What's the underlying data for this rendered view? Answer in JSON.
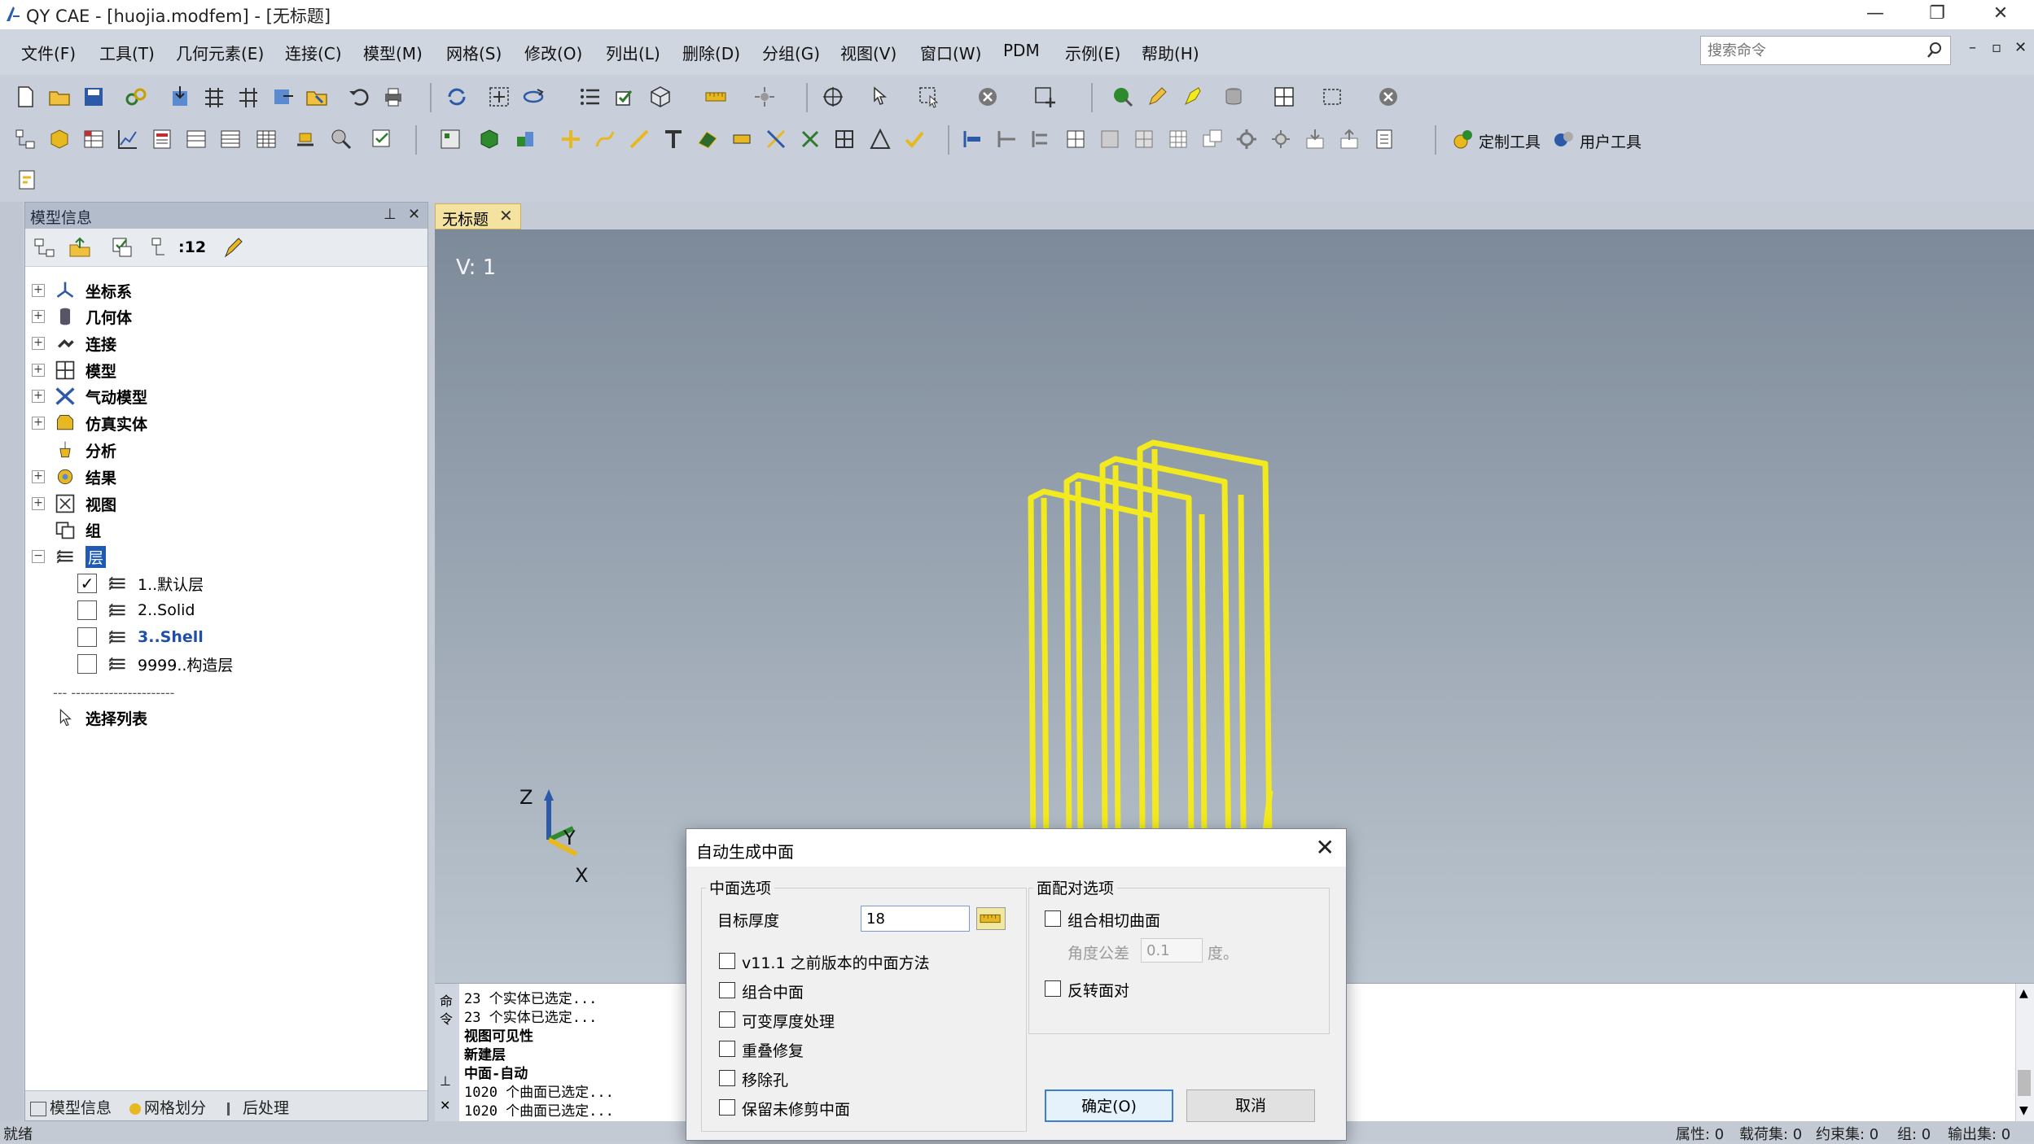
{
  "window": {
    "title": "QY CAE - [huojia.modfem] - [无标题]",
    "minimize": "—",
    "restore": "❐",
    "close": "✕"
  },
  "menu": {
    "items": [
      "文件(F)",
      "工具(T)",
      "几何元素(E)",
      "连接(C)",
      "模型(M)",
      "网格(S)",
      "修改(O)",
      "列出(L)",
      "删除(D)",
      "分组(G)",
      "视图(V)",
      "窗口(W)",
      "PDM",
      "示例(E)",
      "帮助(H)"
    ],
    "search_placeholder": "搜索命令",
    "mdi_min": "–",
    "mdi_restore": "▫",
    "mdi_close": "✕"
  },
  "toolbar": {
    "custom_tools": "定制工具",
    "user_tools": "用户工具"
  },
  "left_panel": {
    "title": "模型信息",
    "pin": "⊥",
    "close": "✕",
    "layer_count": ":12",
    "tree": [
      {
        "label": "坐标系",
        "expand": "+"
      },
      {
        "label": "几何体",
        "expand": "+"
      },
      {
        "label": "连接",
        "expand": "+"
      },
      {
        "label": "模型",
        "expand": "+"
      },
      {
        "label": "气动模型",
        "expand": "+"
      },
      {
        "label": "仿真实体",
        "expand": "+"
      },
      {
        "label": "分析",
        "expand": ""
      },
      {
        "label": "结果",
        "expand": "+"
      },
      {
        "label": "视图",
        "expand": "+"
      },
      {
        "label": "组",
        "expand": ""
      },
      {
        "label": "层",
        "expand": "−"
      }
    ],
    "layers": [
      {
        "label": "1..默认层",
        "checked": "✓"
      },
      {
        "label": "2..Solid",
        "checked": ""
      },
      {
        "label": "3..Shell",
        "checked": ""
      },
      {
        "label": "9999..构造层",
        "checked": ""
      }
    ],
    "separator": "--- ----------------------",
    "selection_list": "选择列表",
    "tabs": [
      "模型信息",
      "网格划分",
      "后处理"
    ]
  },
  "document": {
    "tab_label": "无标题",
    "tab_close": "✕",
    "view_label": "V: 1",
    "axis_z": "Z",
    "axis_y": "Y",
    "axis_x": "X",
    "model_color": "#f2ea1e"
  },
  "output": {
    "strip_labels": [
      "命",
      "令",
      "⊥",
      "✕"
    ],
    "lines": [
      "23 个实体已选定...",
      "23 个实体已选定...",
      "视图可见性",
      "新建层",
      "中面-自动",
      "1020 个曲面已选定...",
      "1020 个曲面已选定..."
    ]
  },
  "status": {
    "left": "就绪",
    "fields": [
      "属性: 0",
      "载荷集: 0",
      "约束集: 0",
      "组: 0",
      "输出集: 0"
    ]
  },
  "dialog": {
    "title": "自动生成中面",
    "close": "✕",
    "midsurface_group": "中面选项",
    "target_thickness_label": "目标厚度",
    "target_thickness_value": "18",
    "ruler_icon": "ruler-icon",
    "options": [
      "v11.1 之前版本的中面方法",
      "组合中面",
      "可变厚度处理",
      "重叠修复",
      "移除孔",
      "保留未修剪中面"
    ],
    "pairing_group": "面配对选项",
    "combine_tangent": "组合相切曲面",
    "angle_tol_label": "角度公差",
    "angle_tol_value": "0.1",
    "angle_unit": "度。",
    "reverse_pair": "反转面对",
    "ok": "确定(O)",
    "cancel": "取消"
  }
}
